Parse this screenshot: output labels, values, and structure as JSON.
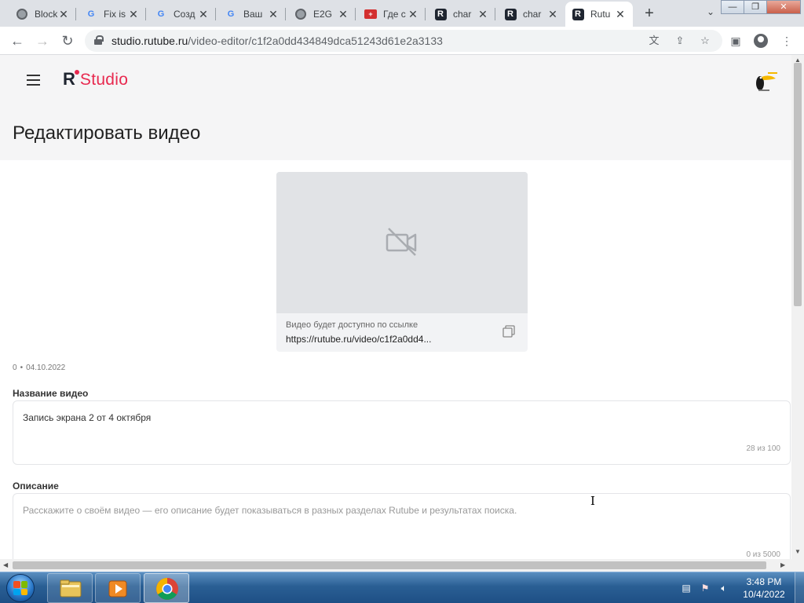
{
  "browser": {
    "tabs": [
      {
        "title": "Block",
        "icon": "globe-icon"
      },
      {
        "title": "Fix is",
        "icon": "google-icon"
      },
      {
        "title": "Созд",
        "icon": "google-icon"
      },
      {
        "title": "Ваш",
        "icon": "google-icon"
      },
      {
        "title": "E2G",
        "icon": "globe-icon"
      },
      {
        "title": "Где с",
        "icon": "red-flag-icon"
      },
      {
        "title": "char",
        "icon": "rutube-icon"
      },
      {
        "title": "char",
        "icon": "rutube-icon"
      },
      {
        "title": "Rutu",
        "icon": "rutube-icon",
        "active": true
      }
    ],
    "new_tab_label": "+",
    "url_host": "studio.rutube.ru",
    "url_path": "/video-editor/c1f2a0dd434849dca51243d61e2a3133"
  },
  "app": {
    "logo_letter": "R",
    "logo_text": "Studio",
    "brand_color": "#e8294f"
  },
  "page": {
    "title": "Редактировать видео"
  },
  "preview": {
    "link_caption": "Видео будет доступно по ссылке",
    "link_url": "https://rutube.ru/video/c1f2a0dd4..."
  },
  "meta": {
    "views": "0",
    "date": "04.10.2022"
  },
  "fields": {
    "name": {
      "label": "Название видео",
      "value": "Запись экрана 2 от 4 октября",
      "counter": "28 из 100"
    },
    "description": {
      "label": "Описание",
      "placeholder": "Расскажите о своём видео — его описание будет показываться в разных  разделах Rutube и результатах поиска.",
      "counter": "0 из 5000"
    }
  },
  "taskbar": {
    "time": "3:48 PM",
    "date": "10/4/2022"
  }
}
